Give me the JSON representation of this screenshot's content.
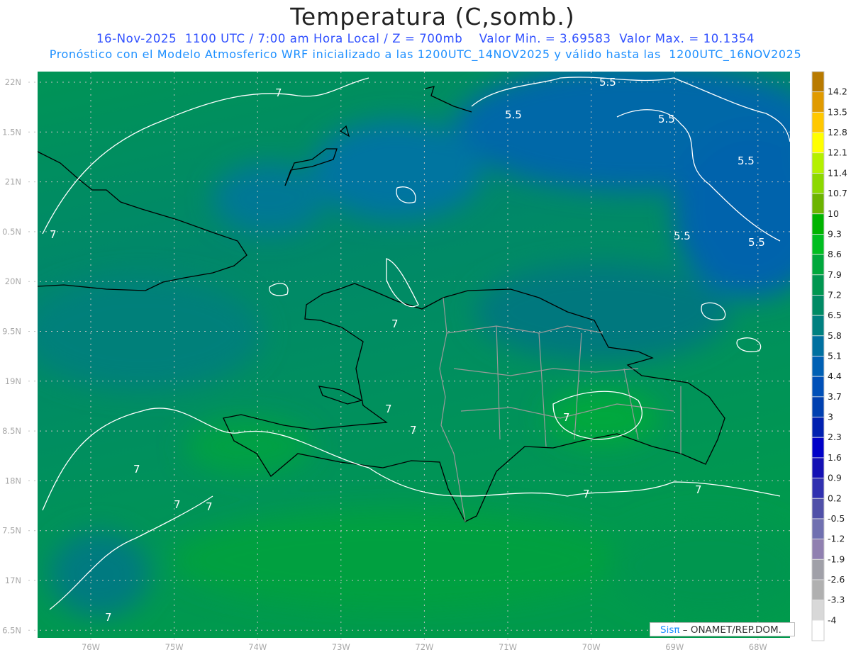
{
  "header": {
    "title": "Temperatura (C,somb.)",
    "line1": "16-Nov-2025  1100 UTC / 7:00 am Hora Local / Z = 700mb    Valor Min. = 3.69583  Valor Max. = 10.1354",
    "line2": "Pronóstico con el Modelo Atmosferico WRF inicializado a las 1200UTC_14NOV2025 y válido hasta las  1200UTC_16NOV2025"
  },
  "axes": {
    "lat_labels": [
      "22N",
      "1.5N",
      "21N",
      "0.5N",
      "20N",
      "9.5N",
      "19N",
      "8.5N",
      "18N",
      "7.5N",
      "17N",
      "6.5N"
    ],
    "lon_labels": [
      "76W",
      "75W",
      "74W",
      "73W",
      "72W",
      "71W",
      "70W",
      "69W",
      "68W"
    ]
  },
  "contours": {
    "labels": [
      "7",
      "7",
      "7",
      "7",
      "7",
      "7",
      "7",
      "7",
      "7",
      "7",
      "7",
      "7",
      "5.5",
      "5.5",
      "5.5",
      "5.5",
      "5.5",
      "5.5"
    ]
  },
  "colorbar": {
    "labels": [
      "14.2",
      "13.5",
      "12.8",
      "12.1",
      "11.4",
      "10.7",
      "10",
      "9.3",
      "8.6",
      "7.9",
      "7.2",
      "6.5",
      "5.8",
      "5.1",
      "4.4",
      "3.7",
      "3",
      "2.3",
      "1.6",
      "0.9",
      "0.2",
      "-0.5",
      "-1.2",
      "-1.9",
      "-2.6",
      "-3.3",
      "-4"
    ],
    "colors": [
      "#b87a00",
      "#e09a00",
      "#ffc800",
      "#ffff00",
      "#b4f000",
      "#8cd800",
      "#6cb400",
      "#00b400",
      "#00be20",
      "#00a83c",
      "#009650",
      "#008a64",
      "#008080",
      "#0070a0",
      "#0060b4",
      "#0050b8",
      "#0040b0",
      "#0020b0",
      "#0000c8",
      "#1410b4",
      "#3030b0",
      "#5050a8",
      "#7070b0",
      "#9080b0",
      "#a0a0a8",
      "#b0b0b0",
      "#d8d8d8",
      "#ffffff"
    ]
  },
  "credit": {
    "brand": "Sisπ",
    "text": " – ONAMET/REP.DOM."
  }
}
